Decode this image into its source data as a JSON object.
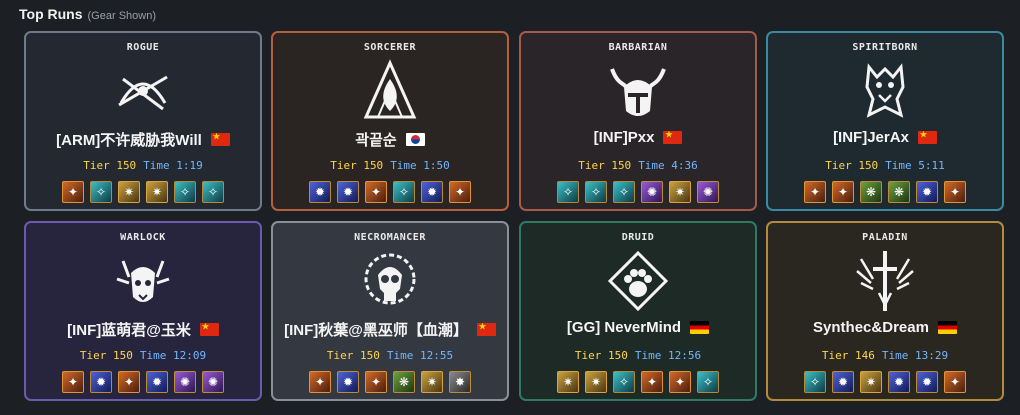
{
  "header": {
    "title": "Top Runs",
    "subtitle": "(Gear Shown)"
  },
  "runs": [
    {
      "class_name": "ROGUE",
      "player": "[ARM]不许威胁我Will",
      "flag": "cn",
      "tier": "Tier 150",
      "time": "Time 1:19",
      "emblem_icon": "rogue-emblem-icon",
      "gear": [
        "r",
        "t",
        "g",
        "g",
        "t",
        "t"
      ],
      "border": "#6f7b8c",
      "bg": "#232831"
    },
    {
      "class_name": "SORCERER",
      "player": "곽끝순",
      "flag": "kr",
      "tier": "Tier 150",
      "time": "Time 1:50",
      "emblem_icon": "sorcerer-emblem-icon",
      "gear": [
        "b",
        "b",
        "r",
        "t",
        "b",
        "r"
      ],
      "border": "#b5603d",
      "bg": "#2a2522"
    },
    {
      "class_name": "BARBARIAN",
      "player": "[INF]Pxx",
      "flag": "cn",
      "tier": "Tier 150",
      "time": "Time 4:36",
      "emblem_icon": "barbarian-emblem-icon",
      "gear": [
        "t",
        "t",
        "t",
        "p",
        "g",
        "p"
      ],
      "border": "#a55a4a",
      "bg": "#2a2528"
    },
    {
      "class_name": "SPIRITBORN",
      "player": "[INF]JerAx",
      "flag": "cn",
      "tier": "Tier 150",
      "time": "Time 5:11",
      "emblem_icon": "spiritborn-emblem-icon",
      "gear": [
        "r",
        "r",
        "v",
        "v",
        "b",
        "r"
      ],
      "border": "#3a8aa0",
      "bg": "#1e2a30"
    },
    {
      "class_name": "WARLOCK",
      "player": "[INF]蓝萌君@玉米",
      "flag": "cn",
      "tier": "Tier 150",
      "time": "Time 12:09",
      "emblem_icon": "warlock-emblem-icon",
      "gear": [
        "r",
        "b",
        "r",
        "b",
        "p",
        "p"
      ],
      "border": "#6a5ab0",
      "bg": "#27253d"
    },
    {
      "class_name": "NECROMANCER",
      "player": "[INF]秋葉@黑巫师【血潮】",
      "flag": "cn",
      "tier": "Tier 150",
      "time": "Time 12:55",
      "emblem_icon": "necromancer-emblem-icon",
      "gear": [
        "r",
        "b",
        "r",
        "v",
        "g",
        "k"
      ],
      "border": "#8a9098",
      "bg": "#343841"
    },
    {
      "class_name": "DRUID",
      "player": "[GG] NeverMind",
      "flag": "de",
      "tier": "Tier 150",
      "time": "Time 12:56",
      "emblem_icon": "druid-emblem-icon",
      "gear": [
        "g",
        "g",
        "t",
        "r",
        "r",
        "t"
      ],
      "border": "#2f7a62",
      "bg": "#1e2a26"
    },
    {
      "class_name": "PALADIN",
      "player": "Synthec&Dream",
      "flag": "de",
      "tier": "Tier 146",
      "time": "Time 13:29",
      "emblem_icon": "paladin-emblem-icon",
      "gear": [
        "t",
        "b",
        "g",
        "b",
        "b",
        "r"
      ],
      "border": "#b48a3c",
      "bg": "#2a2720"
    }
  ]
}
